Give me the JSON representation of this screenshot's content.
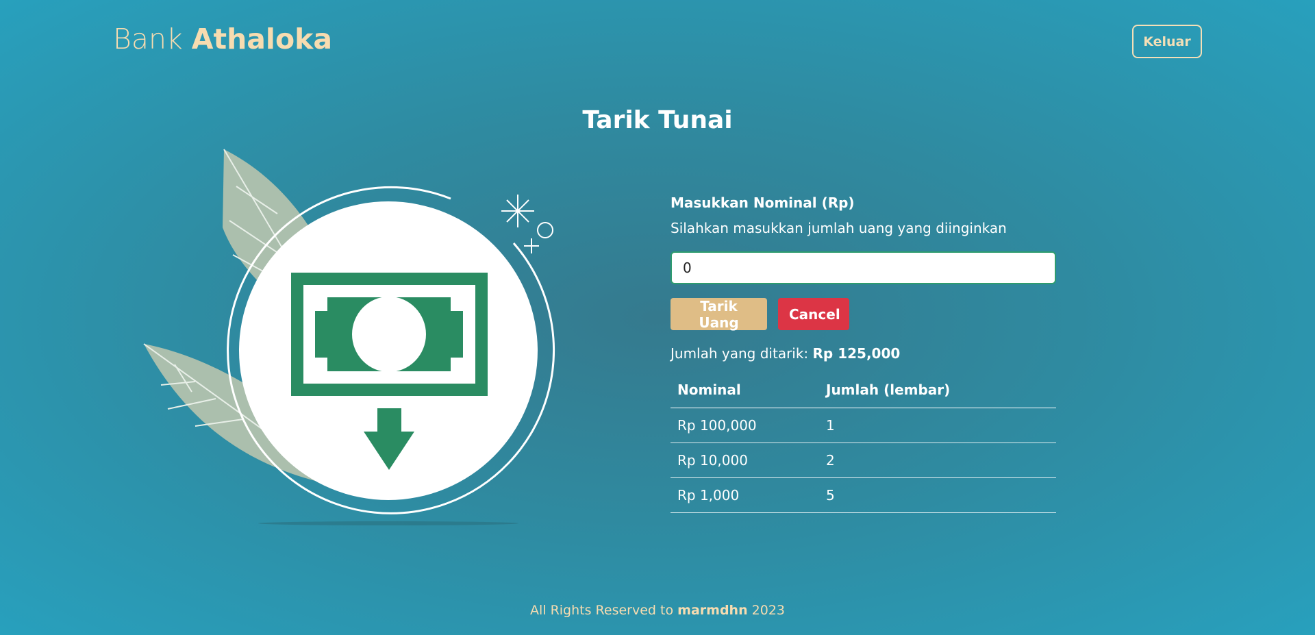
{
  "header": {
    "brand_prefix": "Bank",
    "brand_name": "Athaloka",
    "logout_label": "Keluar"
  },
  "page": {
    "title": "Tarik Tunai"
  },
  "form": {
    "label": "Masukkan Nominal (Rp)",
    "hint": "Silahkan masukkan jumlah uang yang diinginkan",
    "input_value": "0",
    "withdraw_label": "Tarik Uang",
    "cancel_label": "Cancel"
  },
  "result": {
    "prefix": "Jumlah yang ditarik:",
    "amount": "Rp 125,000"
  },
  "table": {
    "headers": [
      "Nominal",
      "Jumlah (lembar)"
    ],
    "rows": [
      [
        "Rp 100,000",
        "1"
      ],
      [
        "Rp 10,000",
        "2"
      ],
      [
        "Rp 1,000",
        "5"
      ]
    ]
  },
  "footer": {
    "prefix": "All Rights Reserved to",
    "author": "marmdhn",
    "year": "2023"
  },
  "colors": {
    "accent": "#dfbd86",
    "danger": "#dc3545",
    "money_green": "#2a8c62",
    "leaf": "#abbfad"
  },
  "icons": {
    "illustration": "cash-withdrawal-icon"
  }
}
